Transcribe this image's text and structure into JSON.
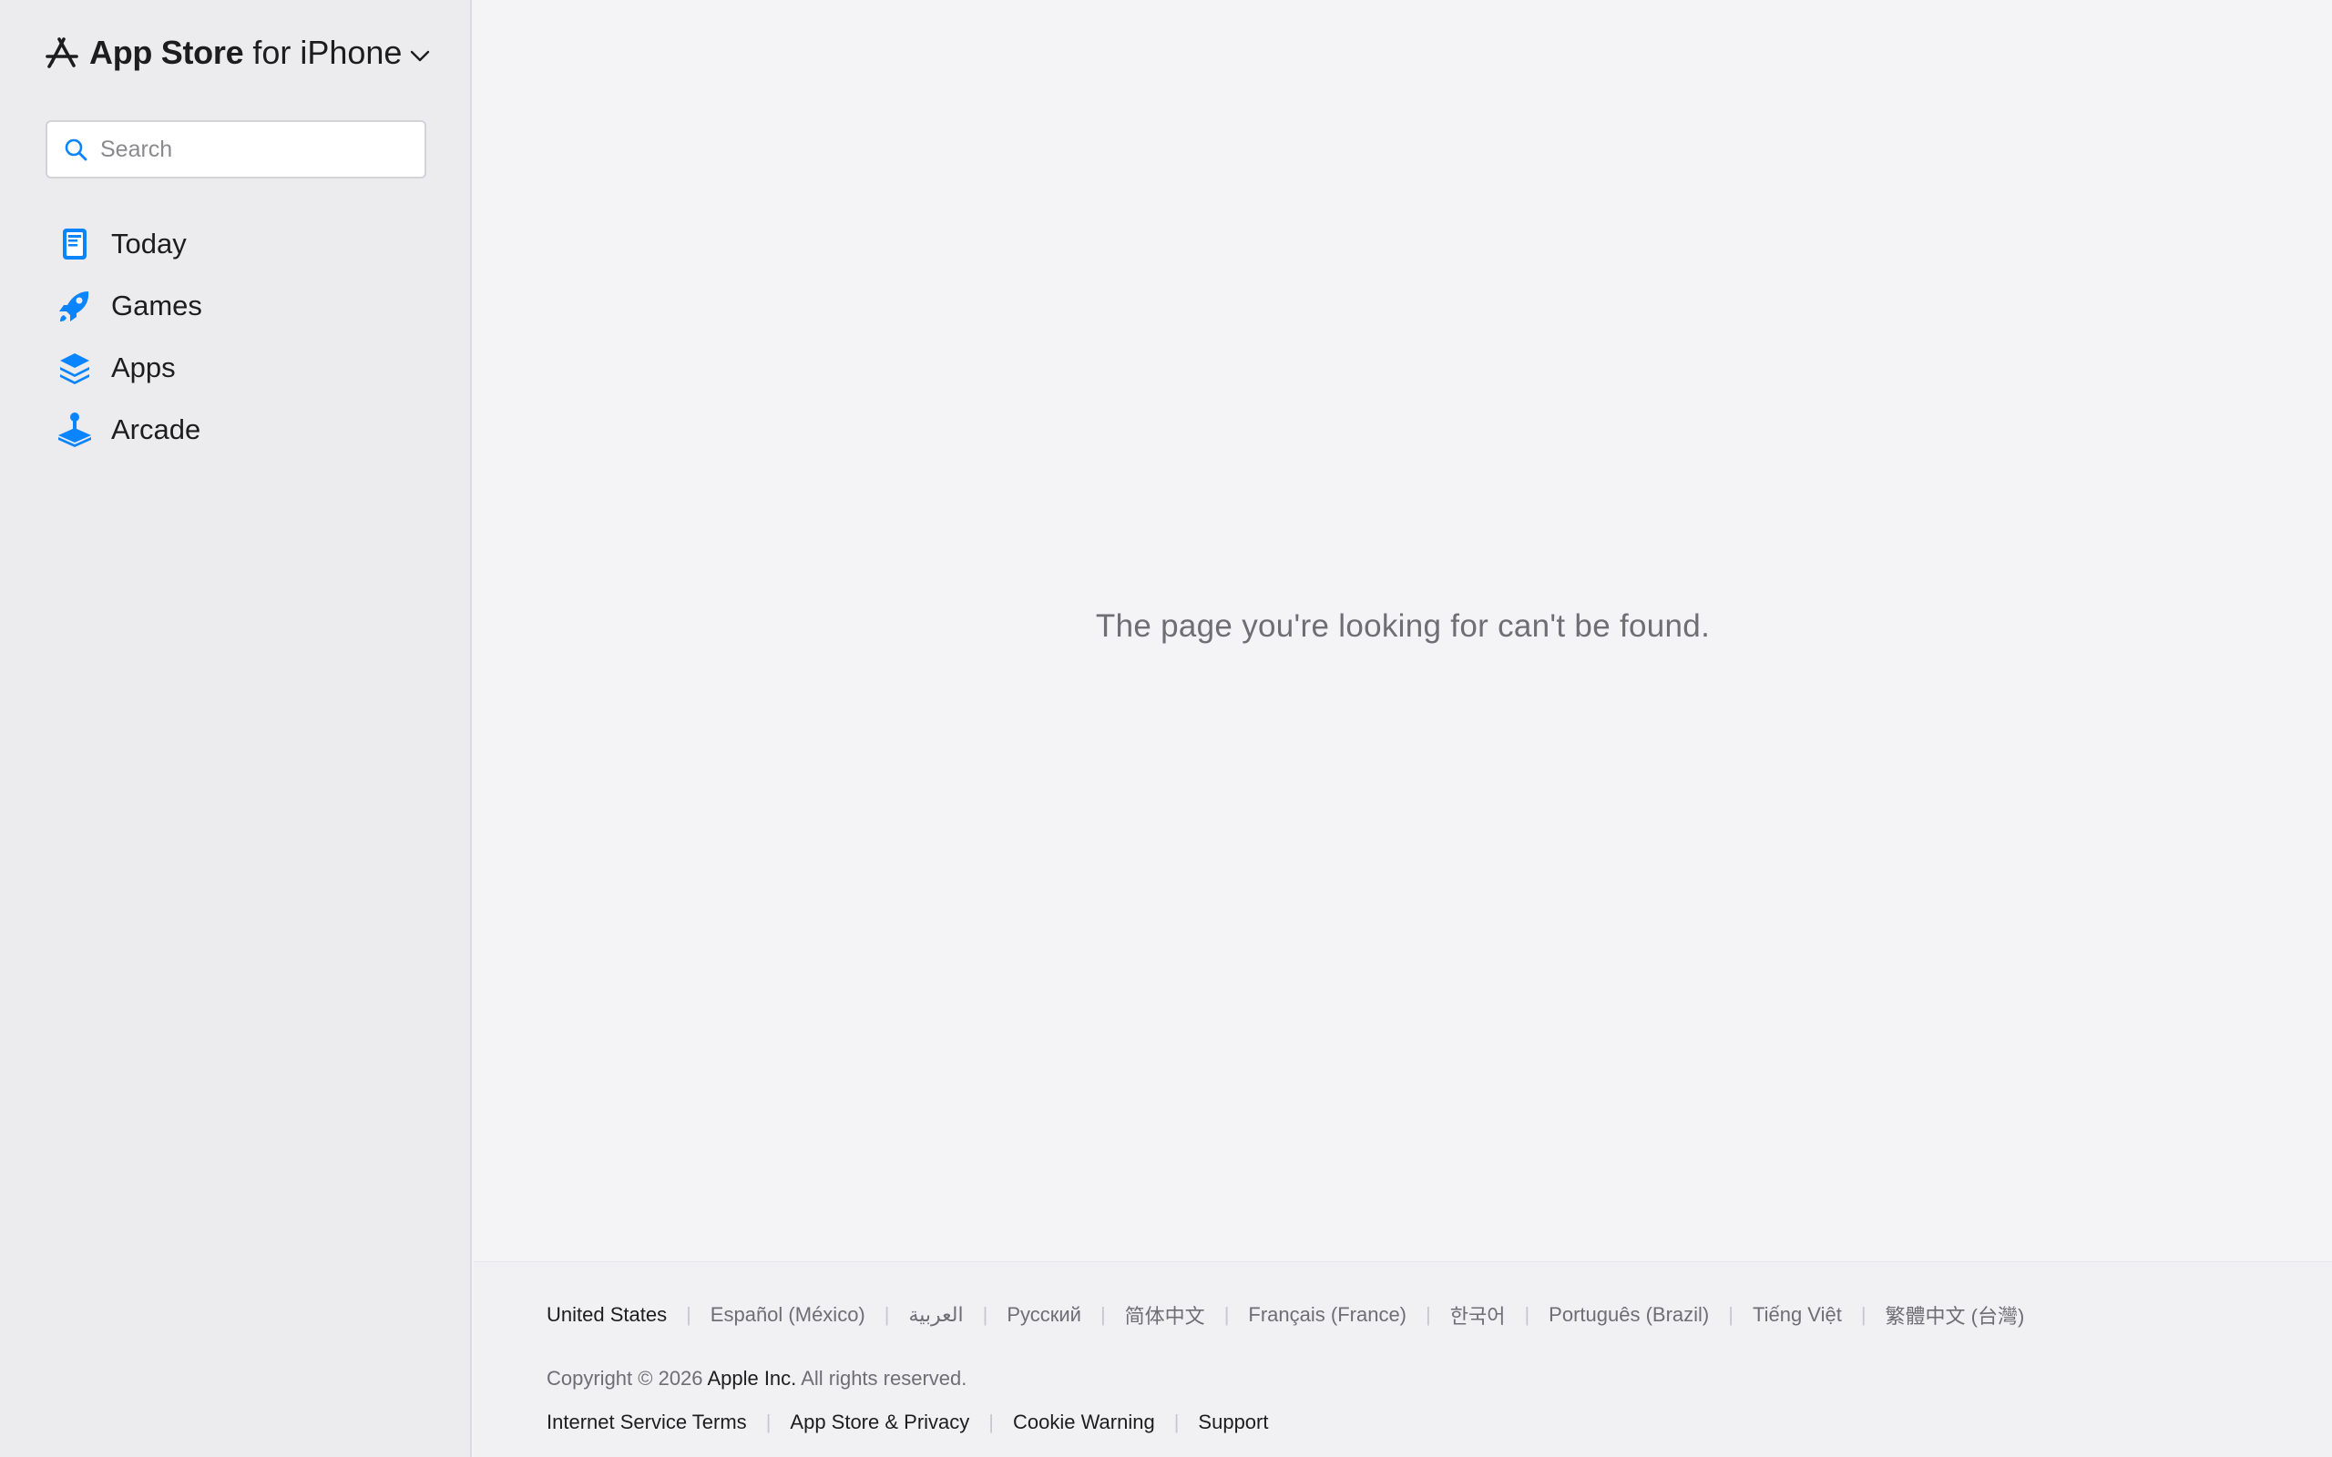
{
  "sidebar": {
    "brand": {
      "name": "App Store",
      "platform": "for iPhone"
    },
    "search": {
      "placeholder": "Search",
      "value": ""
    },
    "nav": [
      {
        "label": "Today",
        "icon": "today-icon"
      },
      {
        "label": "Games",
        "icon": "rocket-icon"
      },
      {
        "label": "Apps",
        "icon": "apps-stack-icon"
      },
      {
        "label": "Arcade",
        "icon": "joystick-icon"
      }
    ]
  },
  "main": {
    "message": "The page you're looking for can't be found."
  },
  "footer": {
    "languages": [
      "United States",
      "Español (México)",
      "العربية",
      "Русский",
      "简体中文",
      "Français (France)",
      "한국어",
      "Português (Brazil)",
      "Tiếng Việt",
      "繁體中文 (台灣)"
    ],
    "copyright": {
      "prefix": "Copyright © 2026",
      "company": "Apple Inc.",
      "suffix": "All rights reserved."
    },
    "legal_links": [
      "Internet Service Terms",
      "App Store & Privacy",
      "Cookie Warning",
      "Support"
    ]
  },
  "colors": {
    "accent": "#0a84ff",
    "sidebar_bg": "#ececef",
    "page_bg": "#f4f4f6",
    "text": "#1d1d1f",
    "muted_text": "#6e6e73"
  }
}
